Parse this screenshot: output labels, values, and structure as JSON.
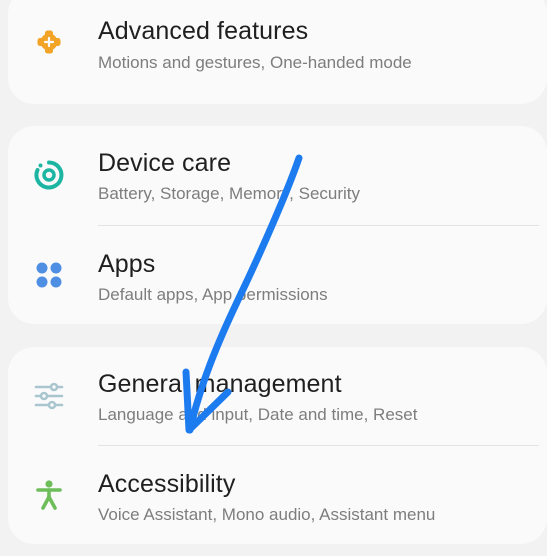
{
  "groups": [
    {
      "items": [
        {
          "icon": "advanced-features-icon",
          "title": "Advanced features",
          "subtitle": "Motions and gestures, One-handed mode",
          "icon_color": "#f2a426"
        }
      ]
    },
    {
      "items": [
        {
          "icon": "device-care-icon",
          "title": "Device care",
          "subtitle": "Battery, Storage, Memory, Security",
          "icon_color": "#1cb5a2"
        },
        {
          "icon": "apps-icon",
          "title": "Apps",
          "subtitle": "Default apps, App permissions",
          "icon_color": "#4f8fe3"
        }
      ]
    },
    {
      "items": [
        {
          "icon": "general-management-icon",
          "title": "General management",
          "subtitle": "Language and input, Date and time, Reset",
          "icon_color": "#a9c6cf"
        },
        {
          "icon": "accessibility-icon",
          "title": "Accessibility",
          "subtitle": "Voice Assistant, Mono audio, Assistant menu",
          "icon_color": "#6dbd5a"
        }
      ]
    }
  ],
  "annotation": {
    "type": "arrow",
    "color": "#1d7bf0",
    "points_to": "Accessibility"
  }
}
